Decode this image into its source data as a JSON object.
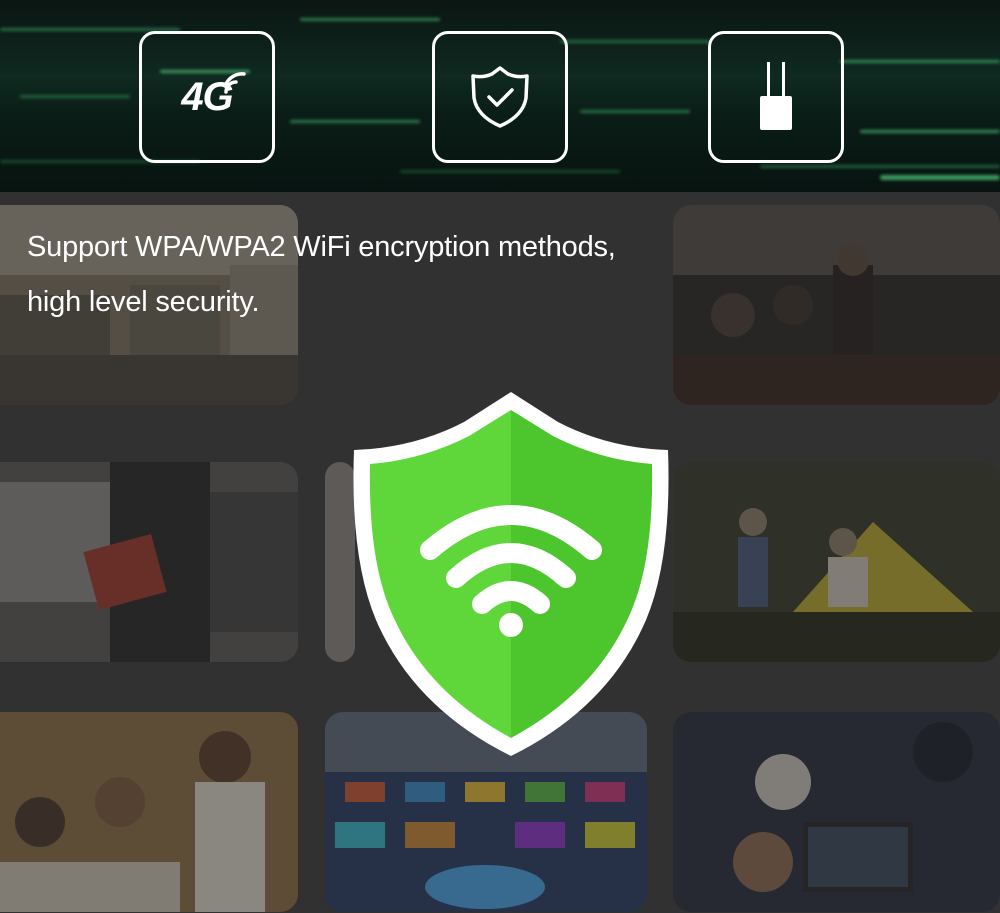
{
  "banner": {
    "features": [
      {
        "icon": "4g-signal-icon",
        "text": "4G"
      },
      {
        "icon": "shield-check-icon"
      },
      {
        "icon": "router-antenna-icon"
      }
    ]
  },
  "headline": {
    "line1": "Support WPA/WPA2 WiFi encryption methods,",
    "line2": "high level security."
  },
  "colors": {
    "shield_green_left": "#5fd73a",
    "shield_green_right": "#4cc62c",
    "banner_dark": "#0b1512",
    "text_white": "#ffffff"
  }
}
